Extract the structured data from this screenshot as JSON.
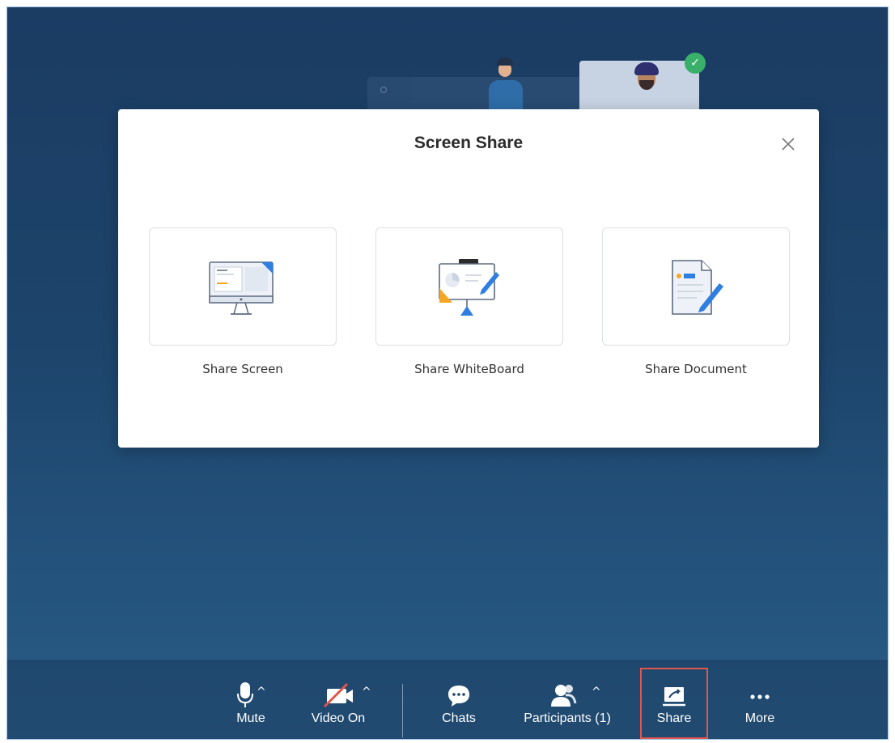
{
  "modal": {
    "title": "Screen Share",
    "options": [
      {
        "label": "Share Screen",
        "icon": "monitor-icon"
      },
      {
        "label": "Share WhiteBoard",
        "icon": "whiteboard-icon"
      },
      {
        "label": "Share Document",
        "icon": "document-icon"
      }
    ]
  },
  "toolbar": {
    "mute": "Mute",
    "video": "Video On",
    "chats": "Chats",
    "participants": "Participants (1)",
    "share": "Share",
    "more": "More"
  },
  "colors": {
    "background_top": "#1b3c63",
    "background_bottom": "#2a5d86",
    "accent_blue": "#2f7fe0",
    "accent_orange": "#f5a623",
    "highlight": "#e0564b"
  }
}
